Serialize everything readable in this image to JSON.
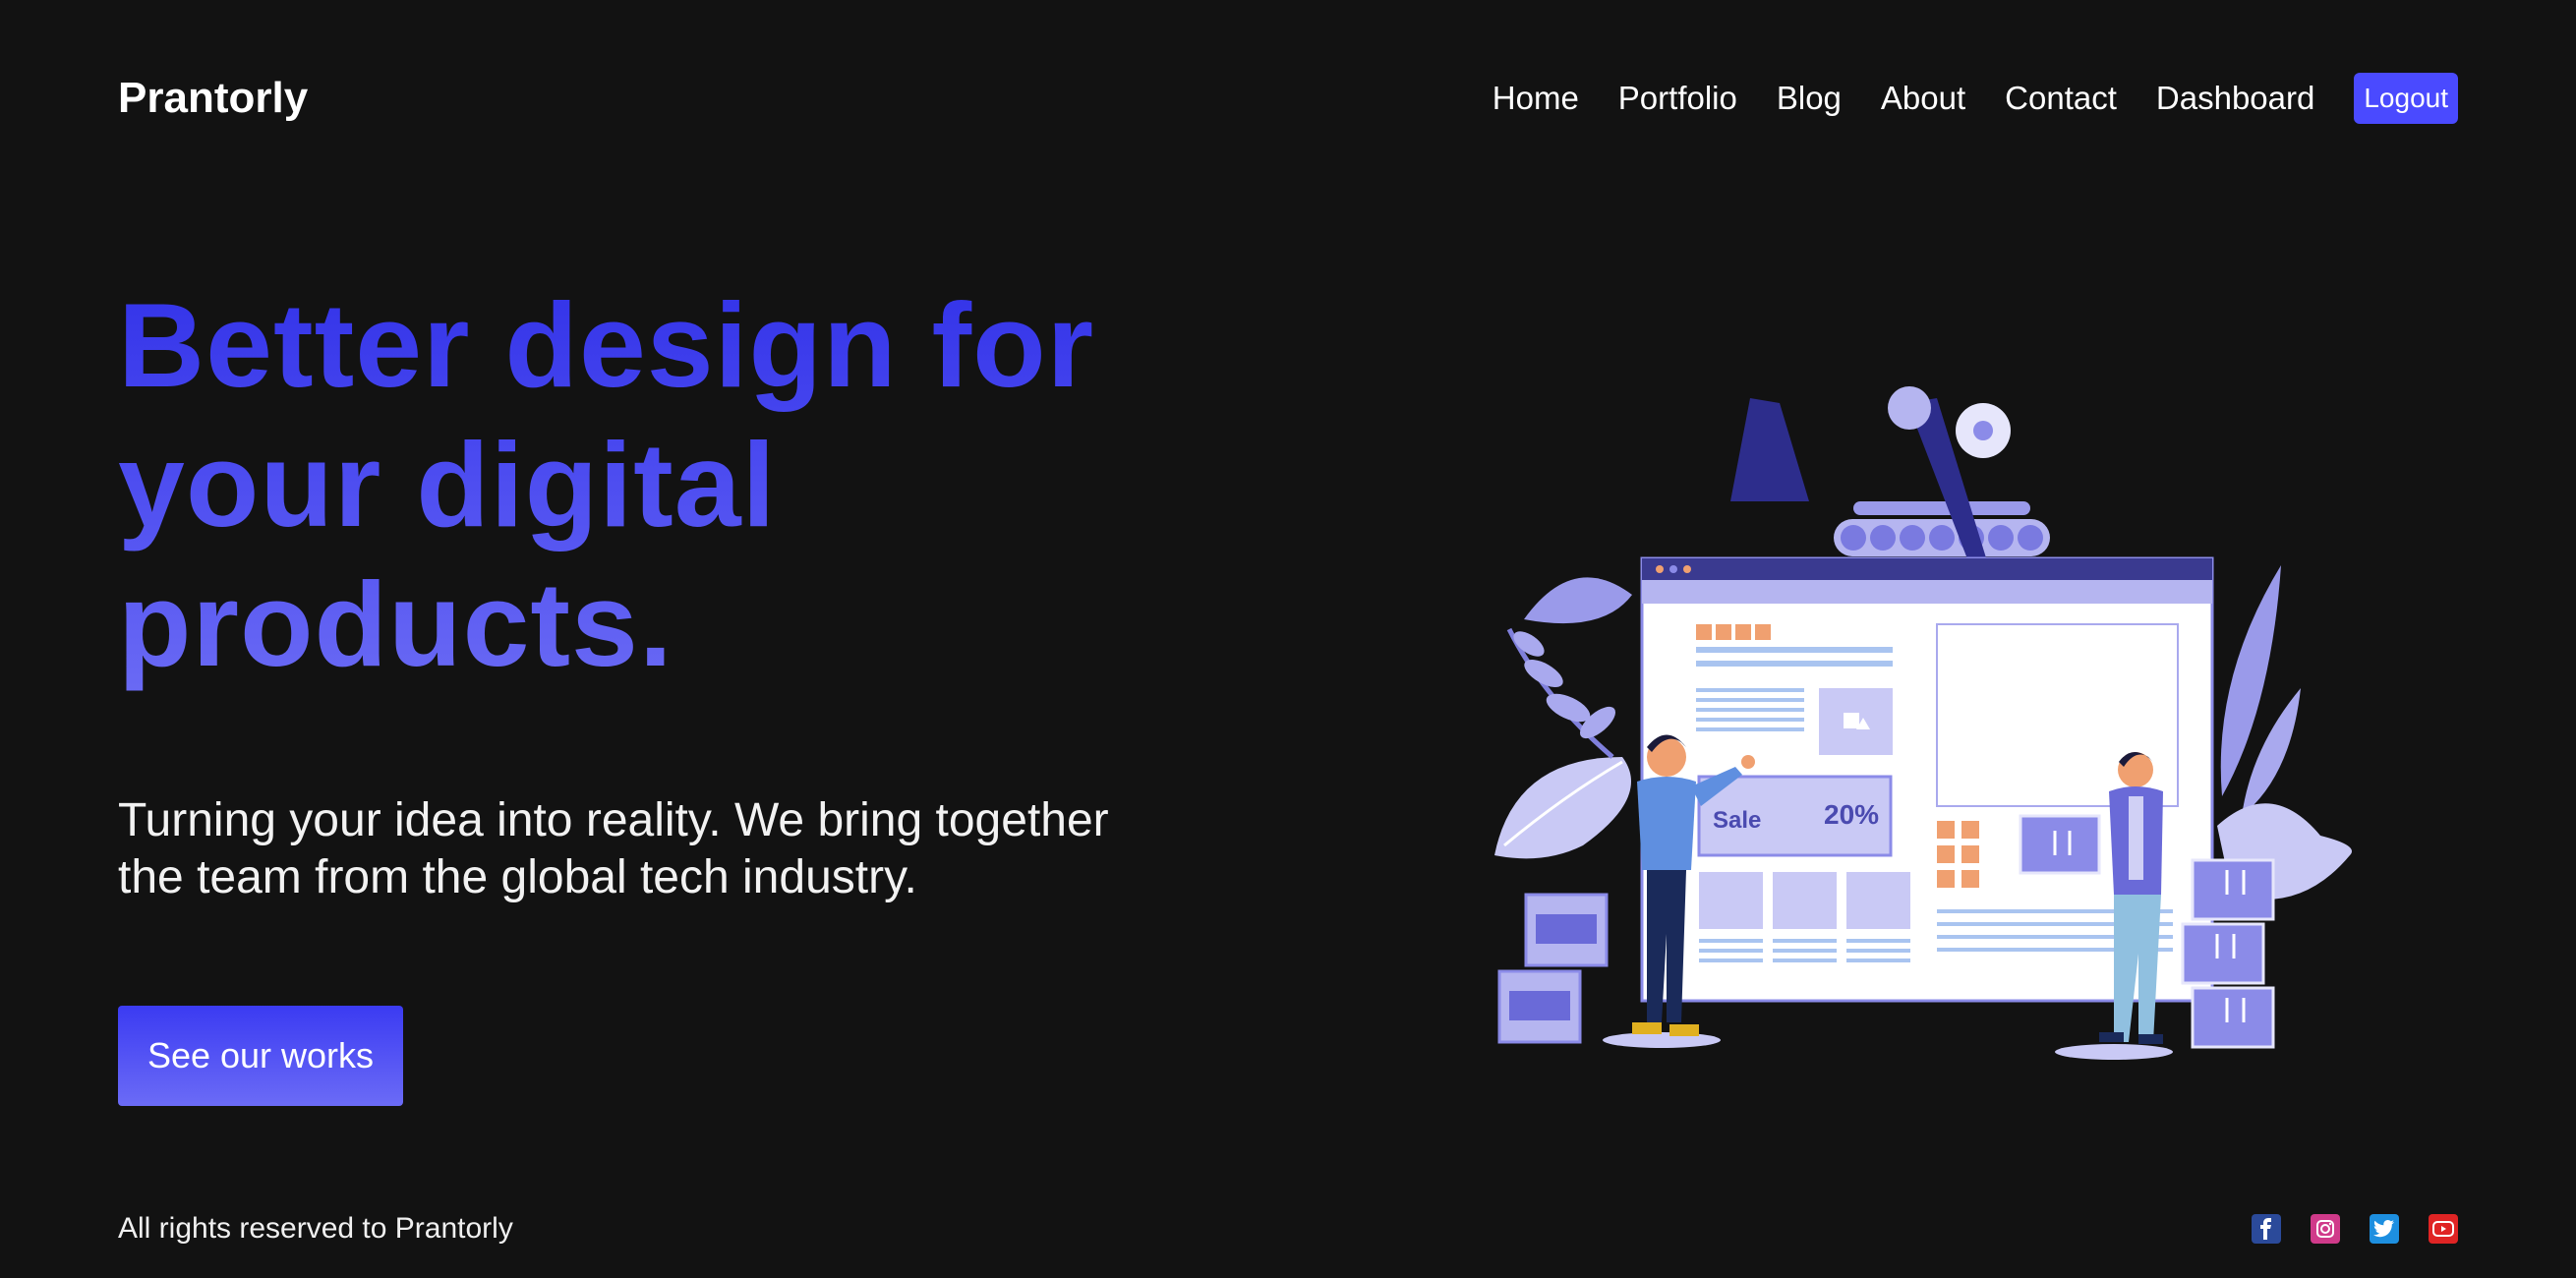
{
  "brand": "Prantorly",
  "nav": {
    "links": [
      "Home",
      "Portfolio",
      "Blog",
      "About",
      "Contact",
      "Dashboard"
    ],
    "logout": "Logout"
  },
  "hero": {
    "title_line1": "Better design for",
    "title_line2": "your digital",
    "title_line3": "products.",
    "subtitle_line1": "Turning your idea into reality. We bring together",
    "subtitle_line2": "the team from the global tech industry.",
    "cta": "See our works"
  },
  "illustration": {
    "sale_text": "Sale",
    "sale_percent": "20%"
  },
  "footer": {
    "copyright": "All rights reserved to Prantorly",
    "socials": [
      "facebook-icon",
      "instagram-icon",
      "twitter-icon",
      "youtube-icon"
    ]
  },
  "colors": {
    "background": "#121212",
    "accent": "#4a4aff",
    "illustration_purple": "#8b8be8"
  }
}
